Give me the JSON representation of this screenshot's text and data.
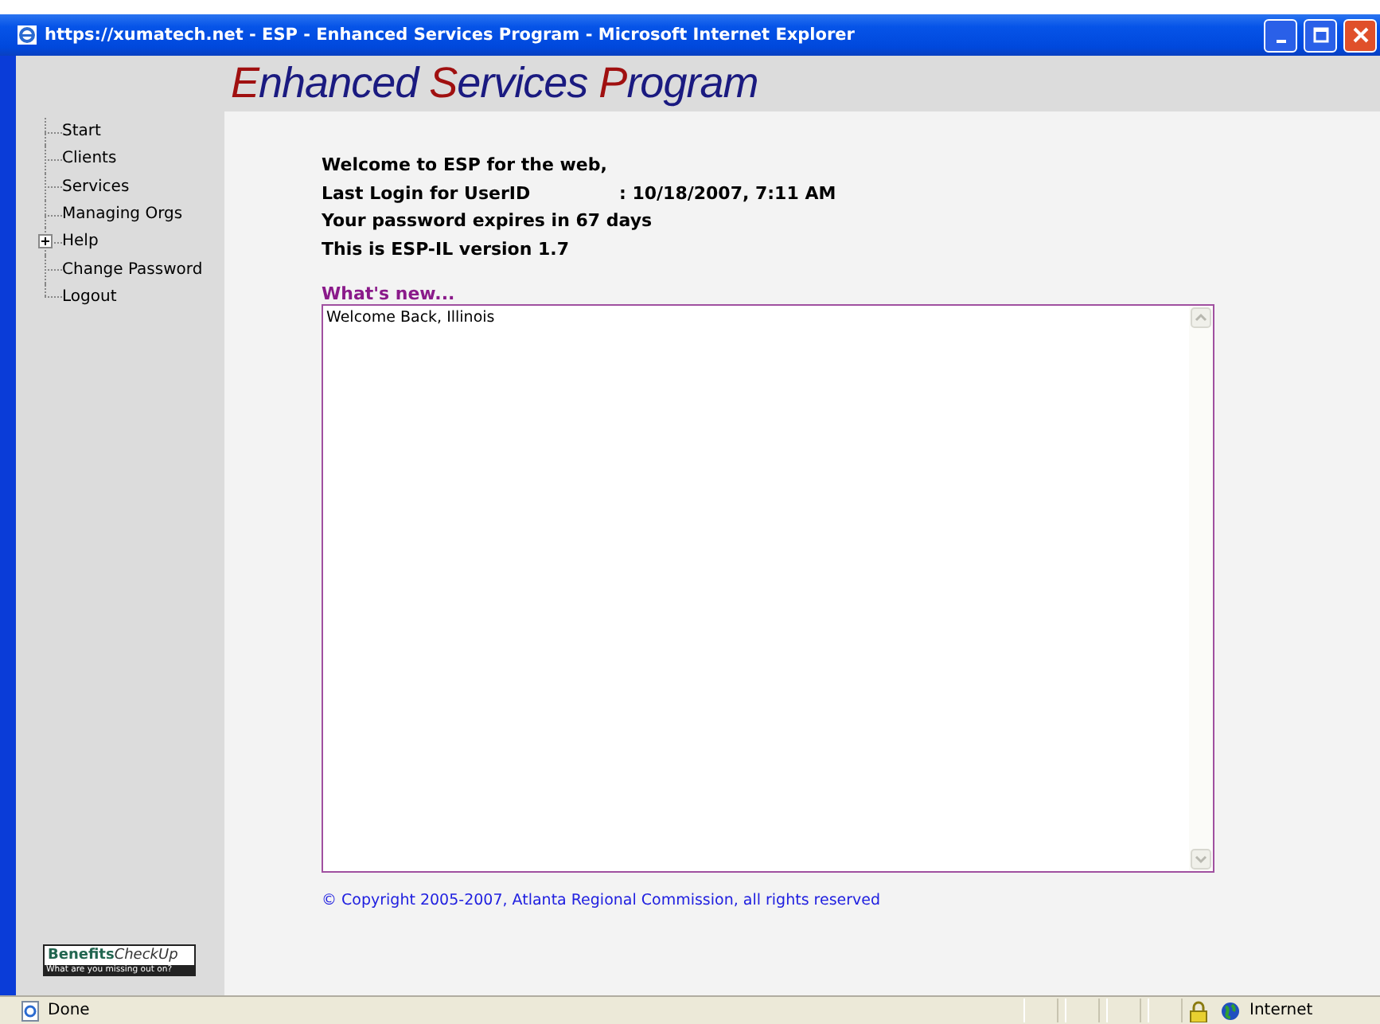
{
  "window": {
    "title": "https://xumatech.net - ESP - Enhanced Services Program - Microsoft Internet Explorer"
  },
  "logo": [
    {
      "text": "E",
      "kind": "initial"
    },
    {
      "text": "nhanced ",
      "kind": "plain"
    },
    {
      "text": "S",
      "kind": "initial"
    },
    {
      "text": "ervices ",
      "kind": "plain"
    },
    {
      "text": "P",
      "kind": "initial"
    },
    {
      "text": "rogram",
      "kind": "plain"
    }
  ],
  "sidebar": {
    "items": [
      {
        "label": "Start",
        "expandable": false
      },
      {
        "label": "Clients",
        "expandable": false
      },
      {
        "label": "Services",
        "expandable": false
      },
      {
        "label": "Managing Orgs",
        "expandable": false
      },
      {
        "label": "Help",
        "expandable": true
      },
      {
        "label": "Change Password",
        "expandable": false
      },
      {
        "label": "Logout",
        "expandable": false
      }
    ],
    "badge": {
      "title_bold": "Benefits",
      "title_light": "CheckUp",
      "tagline": "What are you missing out on?"
    }
  },
  "welcome": [
    "Welcome to ESP for the web,",
    "Your password expires in 67 days",
    "This is ESP-IL version 1.7"
  ],
  "last_login": {
    "label": "Last Login for UserID",
    "value": ": 10/18/2007, 7:11 AM"
  },
  "news": {
    "heading": "What's new...",
    "value": "Welcome Back, Illinois"
  },
  "copyright": "© Copyright 2005-2007, Atlanta Regional Commission, all rights reserved",
  "status_bar": {
    "text": "Done",
    "zone": "Internet"
  }
}
